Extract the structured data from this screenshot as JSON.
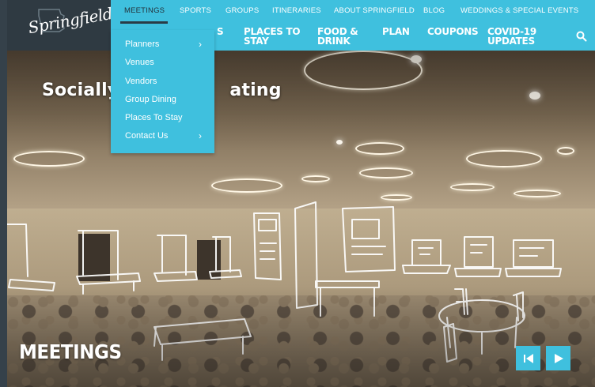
{
  "header": {
    "logo_text": "Springfield",
    "top_nav": [
      {
        "label": "MEETINGS",
        "active": true
      },
      {
        "label": "SPORTS",
        "active": false
      },
      {
        "label": "GROUPS",
        "active": false
      },
      {
        "label": "ITINERARIES",
        "active": false
      },
      {
        "label": "ABOUT SPRINGFIELD",
        "active": false
      },
      {
        "label": "BLOG",
        "active": false
      },
      {
        "label": "WEDDINGS & SPECIAL EVENTS",
        "active": false
      }
    ],
    "main_nav": {
      "partial": "S",
      "places_line1": "PLACES TO",
      "places_line2": "STAY",
      "food_line1": "FOOD &",
      "food_line2": "DRINK",
      "plan": "PLAN",
      "coupons": "COUPONS",
      "covid_line1": "COVID-19",
      "covid_line2": "UPDATES"
    },
    "search_icon": "search-icon"
  },
  "dropdown": {
    "items": [
      {
        "label": "Planners",
        "has_submenu": true
      },
      {
        "label": "Venues",
        "has_submenu": false
      },
      {
        "label": "Vendors",
        "has_submenu": false
      },
      {
        "label": "Group Dining",
        "has_submenu": false
      },
      {
        "label": "Places To Stay",
        "has_submenu": false
      },
      {
        "label": "Contact Us",
        "has_submenu": true
      }
    ],
    "chevron": "›"
  },
  "hero": {
    "heading_visible_left": "Socially",
    "heading_visible_right": "ating",
    "title": "MEETINGS",
    "prev_icon": "previous-icon",
    "next_icon": "next-icon"
  },
  "colors": {
    "accent": "#3fc0de",
    "dark": "#2f3a42",
    "active_text": "#23323b"
  }
}
